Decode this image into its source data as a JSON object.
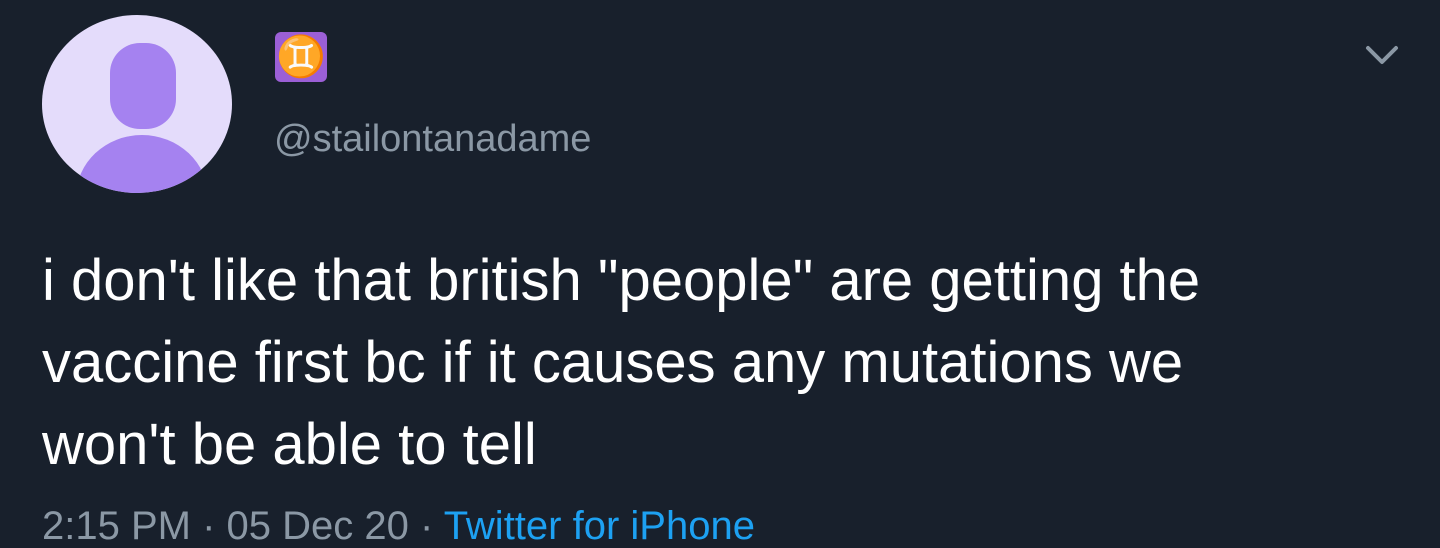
{
  "tweet": {
    "name_glyph": "♊",
    "handle": "@stailontanadame",
    "text": "i don't like that british \"people\" are getting the\nvaccine first bc if it causes any mutations we\nwon't be able to tell",
    "time": "2:15 PM",
    "separator": " · ",
    "date": "05 Dec 20",
    "source": "Twitter for iPhone"
  },
  "icons": {
    "avatar": "default-avatar-icon",
    "menu": "chevron-down-icon"
  },
  "colors": {
    "background": "#18202c",
    "text": "#ffffff",
    "muted": "#8b98a5",
    "link": "#1da1f2",
    "avatar_bg": "#e4dcfb",
    "avatar_fg": "#a582f0",
    "emoji_bg": "#9b5fd6"
  }
}
